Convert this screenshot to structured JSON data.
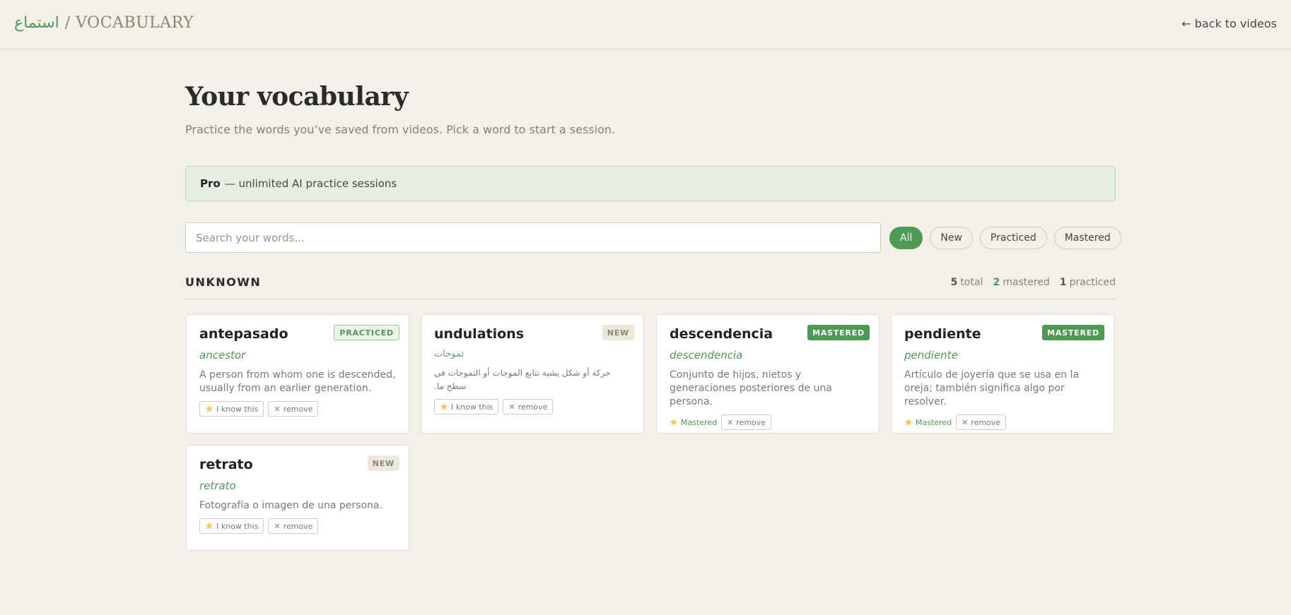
{
  "header": {
    "brand_arabic": "استماع",
    "brand_sep": "/",
    "brand_section": "VOCABULARY",
    "back_link": "← back to videos"
  },
  "page": {
    "title": "Your vocabulary",
    "subtitle": "Practice the words you’ve saved from videos. Pick a word to start a session."
  },
  "pro_banner": {
    "strong": "Pro",
    "text": "— unlimited AI practice sessions"
  },
  "search": {
    "placeholder": "Search your words...",
    "value": ""
  },
  "filters": [
    {
      "label": "All",
      "active": true
    },
    {
      "label": "New",
      "active": false
    },
    {
      "label": "Practiced",
      "active": false
    },
    {
      "label": "Mastered",
      "active": false
    }
  ],
  "section": {
    "title": "UNKNOWN",
    "stats": {
      "total_count": "5",
      "total_label": "total",
      "mastered_count": "2",
      "mastered_label": "mastered",
      "practiced_count": "1",
      "practiced_label": "practiced"
    }
  },
  "cards": [
    {
      "word": "antepasado",
      "badge": "PRACTICED",
      "translation": "ancestor",
      "definition": "A person from whom one is descended, usually from an earlier generation.",
      "know_label": "I know this",
      "remove_label": "remove"
    },
    {
      "word": "undulations",
      "badge": "NEW",
      "translation": "تموجات",
      "definition": "حركة أو شكل يشبه تتابع الموجات أو التموجات في سطح ما.",
      "know_label": "I know this",
      "remove_label": "remove"
    },
    {
      "word": "descendencia",
      "badge": "MASTERED",
      "translation": "descendencia",
      "definition": "Conjunto de hijos, nietos y generaciones posteriores de una persona.",
      "mastered_label": "Mastered",
      "remove_label": "remove"
    },
    {
      "word": "pendiente",
      "badge": "MASTERED",
      "translation": "pendiente",
      "definition": "Artículo de joyería que se usa en la oreja; también significa algo por resolver.",
      "mastered_label": "Mastered",
      "remove_label": "remove"
    },
    {
      "word": "retrato",
      "badge": "NEW",
      "translation": "retrato",
      "definition": "Fotografía o imagen de una persona.",
      "know_label": "I know this",
      "remove_label": "remove"
    }
  ],
  "icons": {
    "star": "star-icon",
    "close": "close-icon"
  },
  "colors": {
    "accent": "#4e9a55",
    "background": "#f3f0e7"
  }
}
